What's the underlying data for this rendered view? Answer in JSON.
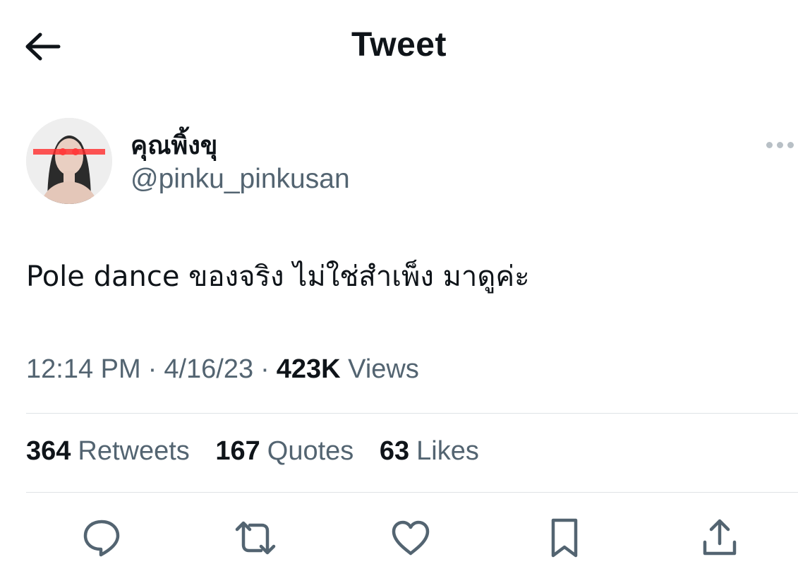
{
  "header": {
    "title": "Tweet",
    "back_icon": "arrow-left-icon"
  },
  "author": {
    "display_name": "คุณพิ้งขุ",
    "handle": "@pinku_pinkusan"
  },
  "tweet": {
    "text": "Pole dance ของจริง ไม่ใช่สำเพ็ง มาดูค่ะ",
    "time": "12:14 PM",
    "date": "4/16/23",
    "separator": "·",
    "views_count": "423K",
    "views_label": "Views"
  },
  "stats": {
    "retweets_count": "364",
    "retweets_label": "Retweets",
    "quotes_count": "167",
    "quotes_label": "Quotes",
    "likes_count": "63",
    "likes_label": "Likes"
  },
  "actions": [
    "reply-icon",
    "retweet-icon",
    "like-icon",
    "bookmark-icon",
    "share-icon"
  ],
  "colors": {
    "text_primary": "#0f1419",
    "text_secondary": "#536471",
    "divider": "#dfe3e6",
    "icon": "#536471"
  }
}
